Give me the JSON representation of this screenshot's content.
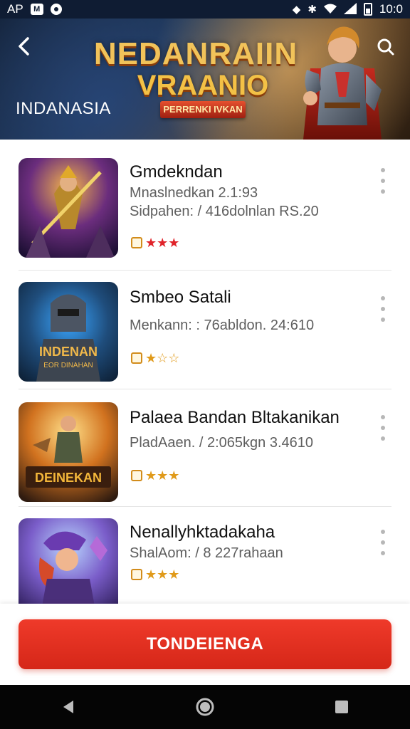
{
  "status_bar": {
    "left_text": "AP",
    "badge_text": "M",
    "time": "10:0",
    "icons": [
      "notification-icon",
      "bluetooth-icon",
      "wifi-icon",
      "signal-icon",
      "battery-icon"
    ]
  },
  "hero": {
    "crest_text": "",
    "title_line1": "NEDANRAIIN",
    "title_line2": "VRAANIO",
    "ribbon_text": "PERRENKI IVKAN",
    "region_label": "INDANASIA",
    "back_icon": "back-arrow-icon",
    "search_icon": "search-icon"
  },
  "games": [
    {
      "title": "Gmdekndan",
      "line1": "Mnaslnedkan 2.1:93",
      "line2": "Sidpahen: / 416dolnlan RS.20",
      "stars": "★★★",
      "star_color": "#e0232a"
    },
    {
      "title": "Smbeo Satali",
      "line1": "Menkann: : 76abldon. 24:610",
      "line2": "",
      "stars": "★☆☆",
      "star_color": "#e09a1a",
      "thumb_text_top": "INDENAN",
      "thumb_text_bottom": "EOR DINAHAN"
    },
    {
      "title": "Palaea Bandan Bltakanikan",
      "line1": "PladAaen. / 2:065kgn 3.4610",
      "line2": "",
      "stars": "★★★",
      "star_color": "#e09a1a",
      "thumb_text": "DEINEKAN"
    },
    {
      "title": "Nenallyhktadakaha",
      "line1": "ShalAom: / 8 227rahaan",
      "line2": "",
      "stars": "★★★",
      "star_color": "#e09a1a"
    }
  ],
  "cta": {
    "label": "TONDEIENGA"
  },
  "colors": {
    "accent_red": "#e3301f",
    "status_bg": "#0f1c33",
    "nav_bg": "#050505"
  }
}
